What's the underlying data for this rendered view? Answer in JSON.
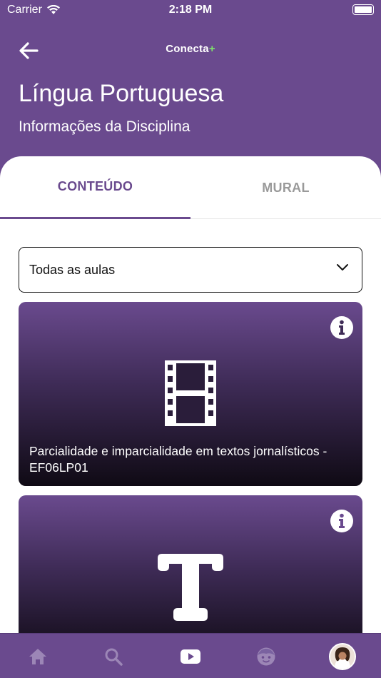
{
  "status_bar": {
    "carrier": "Carrier",
    "time": "2:18 PM"
  },
  "header": {
    "logo_text": "Conecta",
    "logo_plus": "+",
    "title": "Língua Portuguesa",
    "subtitle": "Informações da Disciplina"
  },
  "tabs": [
    {
      "label": "CONTEÚDO",
      "active": true
    },
    {
      "label": "MURAL",
      "active": false
    }
  ],
  "filter": {
    "selected": "Todas as aulas"
  },
  "cards": [
    {
      "icon": "film-icon",
      "title": "Parcialidade e imparcialidade em textos jornalísticos - EF06LP01"
    },
    {
      "icon": "text-icon",
      "title": ""
    }
  ],
  "bottom_nav": [
    "home-icon",
    "search-icon",
    "video-icon",
    "kid-face-icon",
    "profile-avatar"
  ],
  "colors": {
    "brand_purple": "#6a4a8e",
    "active_tab": "#6a4a8e",
    "inactive_tab": "#9a9a9a",
    "logo_plus": "#7ee36b"
  }
}
